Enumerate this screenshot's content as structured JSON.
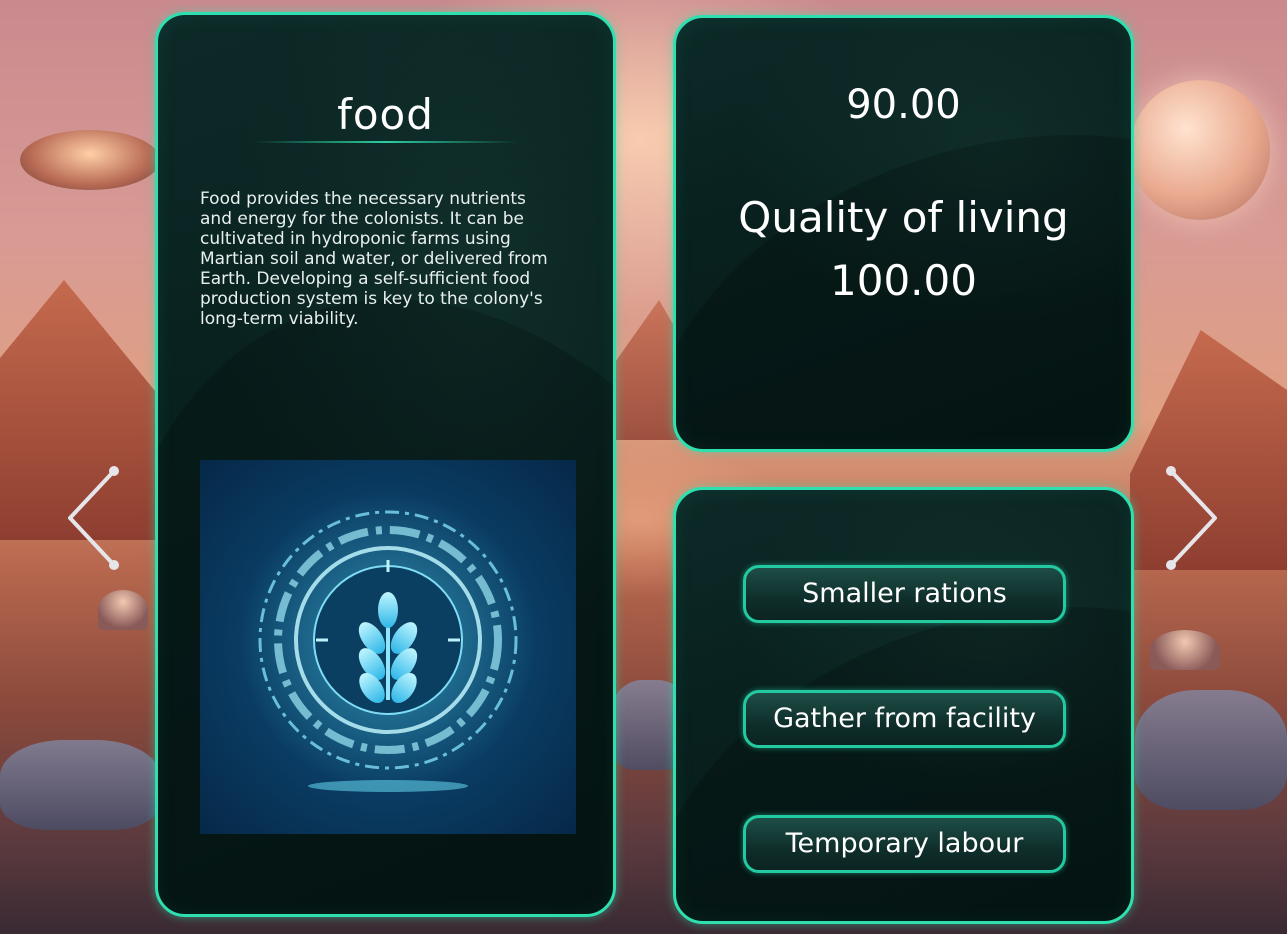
{
  "resource": {
    "title": "food",
    "description": "Food provides the necessary nutrients and energy for the colonists. It can be cultivated in hydroponic farms using Martian soil and water, or delivered from Earth. Developing a self-sufficient food production system is key to the colony's long-term viability.",
    "illustration_icon": "wheat-emblem-icon"
  },
  "stats": {
    "resource_value": "90.00",
    "quality_label": "Quality of living",
    "quality_value": "100.00"
  },
  "actions": [
    {
      "label": "Smaller rations"
    },
    {
      "label": "Gather from facility"
    },
    {
      "label": "Temporary labour"
    }
  ],
  "navigation": {
    "prev_icon": "chevron-left-icon",
    "next_icon": "chevron-right-icon"
  },
  "colors": {
    "accent": "#2ee0b0",
    "panel_bg": "#08201e",
    "text": "#ffffff"
  }
}
